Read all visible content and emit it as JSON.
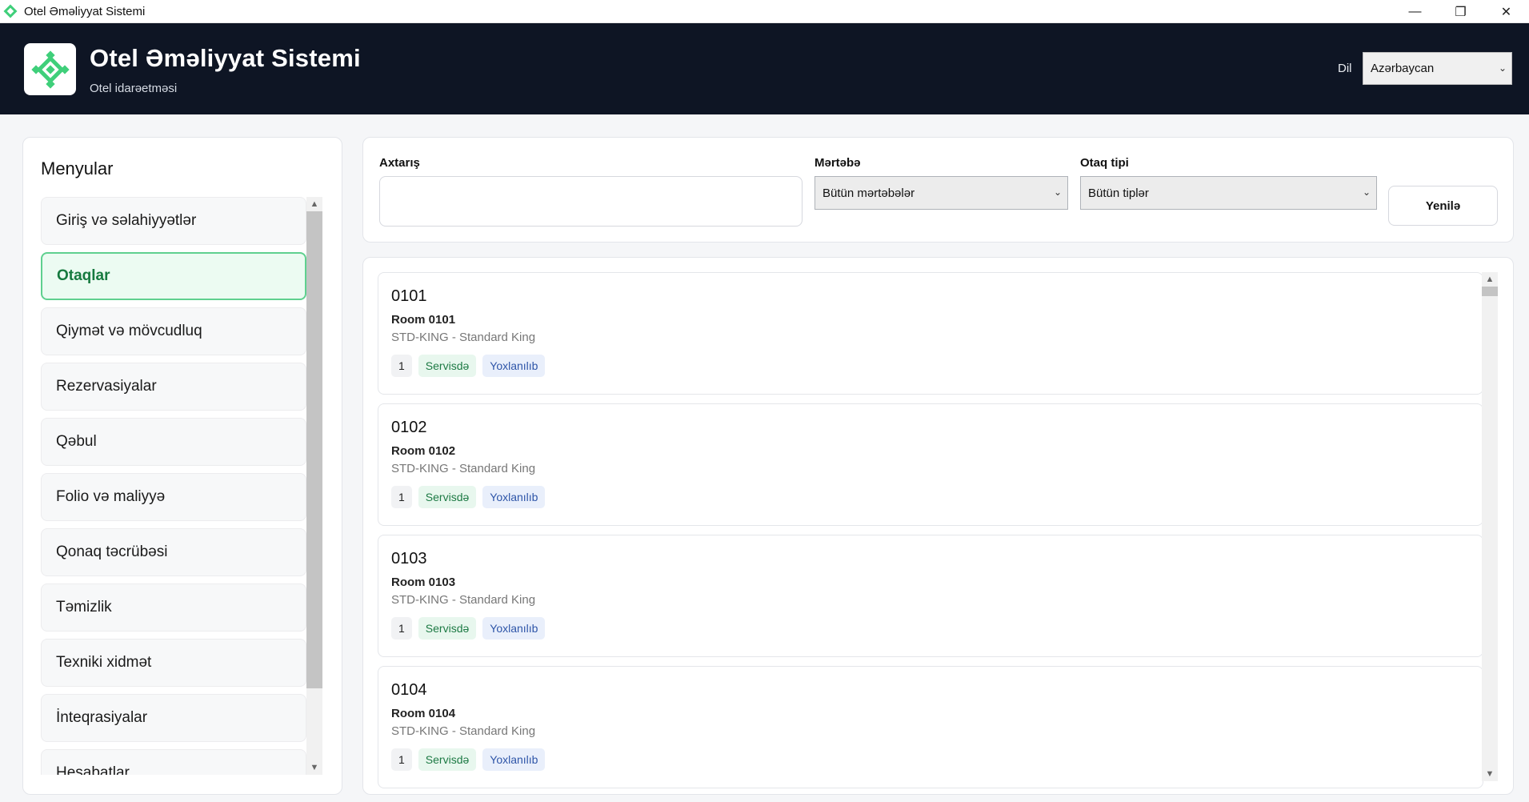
{
  "window": {
    "title": "Otel Əməliyyat Sistemi",
    "controls": {
      "minimize": "—",
      "restore": "❐",
      "close": "✕"
    }
  },
  "header": {
    "title": "Otel Əməliyyat Sistemi",
    "subtitle": "Otel idarəetməsi",
    "language_label": "Dil",
    "language_value": "Azərbaycan",
    "brand_color": "#0e1524",
    "accent_color": "#3fcf7a"
  },
  "sidebar": {
    "title": "Menyular",
    "items": [
      {
        "label": "Giriş və səlahiyyətlər",
        "active": false
      },
      {
        "label": "Otaqlar",
        "active": true
      },
      {
        "label": "Qiymət və mövcudluq",
        "active": false
      },
      {
        "label": "Rezervasiyalar",
        "active": false
      },
      {
        "label": "Qəbul",
        "active": false
      },
      {
        "label": "Folio və maliyyə",
        "active": false
      },
      {
        "label": "Qonaq təcrübəsi",
        "active": false
      },
      {
        "label": "Təmizlik",
        "active": false
      },
      {
        "label": "Texniki xidmət",
        "active": false
      },
      {
        "label": "İnteqrasiyalar",
        "active": false
      },
      {
        "label": "Hesabatlar",
        "active": false
      }
    ]
  },
  "filters": {
    "search_label": "Axtarış",
    "search_value": "",
    "floor_label": "Mərtəbə",
    "floor_value": "Bütün mərtəbələr",
    "room_type_label": "Otaq tipi",
    "room_type_value": "Bütün tiplər",
    "refresh_label": "Yenilə"
  },
  "rooms": [
    {
      "number": "0101",
      "name": "Room 0101",
      "type": "STD-KING - Standard King",
      "floor": "1",
      "status": "Servisdə",
      "inspection": "Yoxlanılıb"
    },
    {
      "number": "0102",
      "name": "Room 0102",
      "type": "STD-KING - Standard King",
      "floor": "1",
      "status": "Servisdə",
      "inspection": "Yoxlanılıb"
    },
    {
      "number": "0103",
      "name": "Room 0103",
      "type": "STD-KING - Standard King",
      "floor": "1",
      "status": "Servisdə",
      "inspection": "Yoxlanılıb"
    },
    {
      "number": "0104",
      "name": "Room 0104",
      "type": "STD-KING - Standard King",
      "floor": "1",
      "status": "Servisdə",
      "inspection": "Yoxlanılıb"
    }
  ]
}
